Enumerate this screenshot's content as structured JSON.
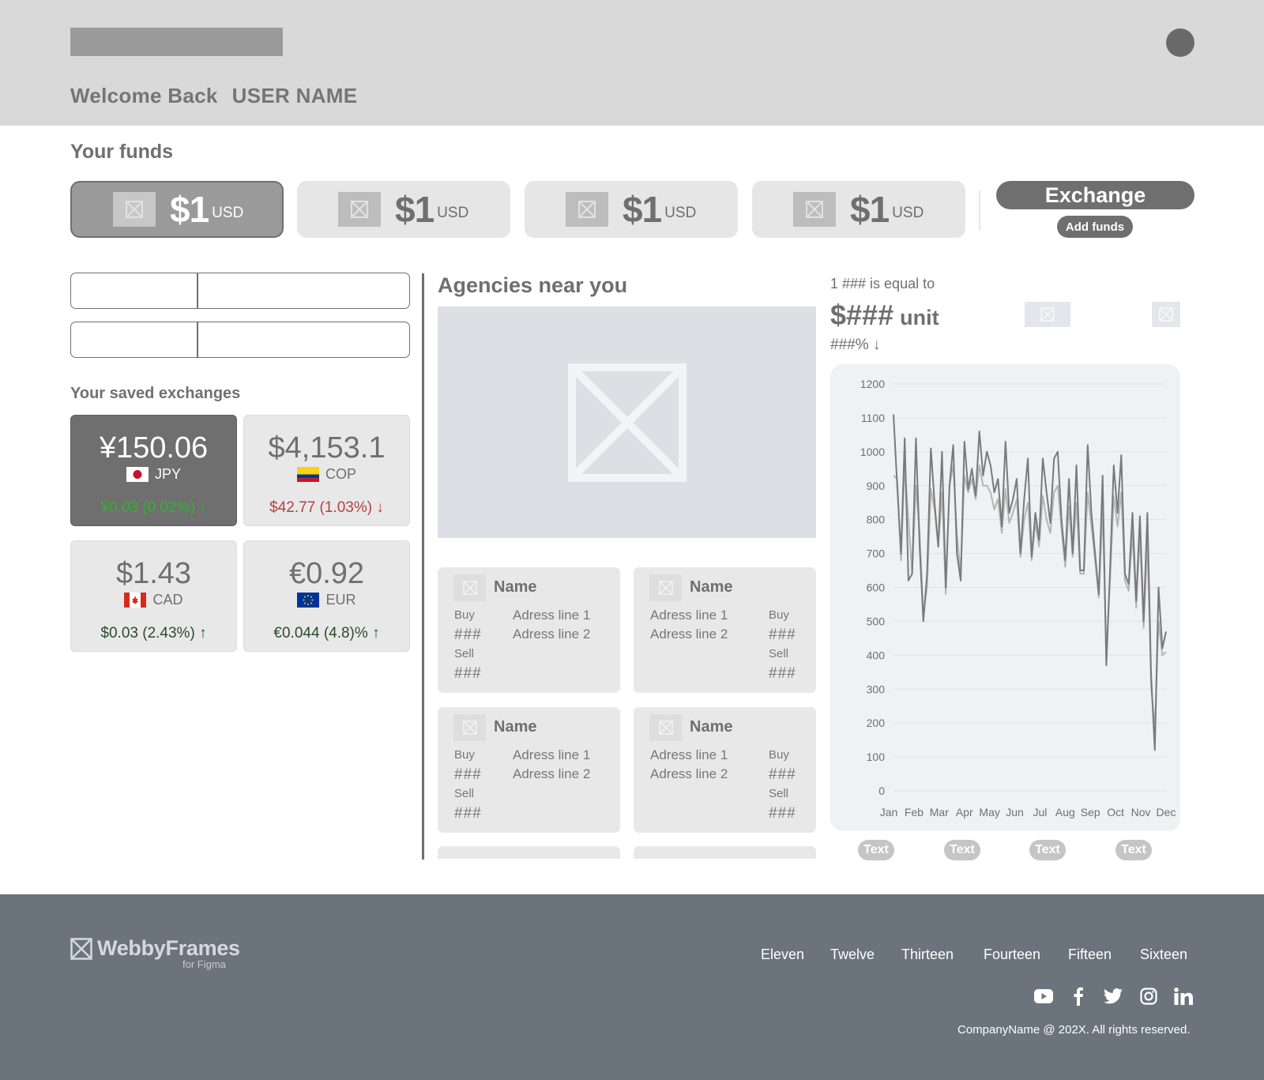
{
  "header": {
    "welcome": "Welcome Back",
    "user_name": "USER NAME"
  },
  "funds": {
    "title": "Your funds",
    "items": [
      {
        "amount": "$1",
        "currency": "USD",
        "active": true
      },
      {
        "amount": "$1",
        "currency": "USD",
        "active": false
      },
      {
        "amount": "$1",
        "currency": "USD",
        "active": false
      },
      {
        "amount": "$1",
        "currency": "USD",
        "active": false
      }
    ],
    "exchange_label": "Exchange",
    "add_funds_label": "Add funds"
  },
  "saved": {
    "title": "Your saved exchanges",
    "cards": [
      {
        "value": "¥150.06",
        "code": "JPY",
        "change": "¥0.03  (0.02%)",
        "direction": "up",
        "flag": "jp"
      },
      {
        "value": "$4,153.1",
        "code": "COP",
        "change": "$42.77 (1.03%)",
        "direction": "down",
        "flag": "co"
      },
      {
        "value": "$1.43",
        "code": "CAD",
        "change": "$0.03  (2.43%)",
        "direction": "up",
        "flag": "ca"
      },
      {
        "value": "€0.92",
        "code": "EUR",
        "change": "€0.044 (4.8)%",
        "direction": "up",
        "flag": "eu"
      }
    ],
    "colors": {
      "up_dark": "#2fb32f",
      "down": "#b54040",
      "up": "#2d4a2d"
    }
  },
  "agencies": {
    "title": "Agencies near you",
    "cards": [
      {
        "name": "Name",
        "buy": "Buy",
        "buy_val": "###",
        "sell": "Sell",
        "sell_val": "###",
        "addr1": "Adress line 1",
        "addr2": "Adress line 2"
      },
      {
        "name": "Name",
        "buy": "Buy",
        "buy_val": "###",
        "sell": "Sell",
        "sell_val": "###",
        "addr1": "Adress line 1",
        "addr2": "Adress line 2"
      },
      {
        "name": "Name",
        "buy": "Buy",
        "buy_val": "###",
        "sell": "Sell",
        "sell_val": "###",
        "addr1": "Adress line 1",
        "addr2": "Adress line 2"
      },
      {
        "name": "Name",
        "buy": "Buy",
        "buy_val": "###",
        "sell": "Sell",
        "sell_val": "###",
        "addr1": "Adress line 1",
        "addr2": "Adress line 2"
      }
    ]
  },
  "rate": {
    "label": "1 ### is equal to",
    "value": "$###",
    "unit": "unit",
    "pct": "###%",
    "pills": [
      "Text",
      "Text",
      "Text",
      "Text"
    ]
  },
  "chart_data": {
    "type": "line",
    "categories": [
      "Jan",
      "Feb",
      "Mar",
      "Apr",
      "May",
      "Jun",
      "Jul",
      "Aug",
      "Sep",
      "Oct",
      "Nov",
      "Dec"
    ],
    "yticks": [
      0,
      100,
      200,
      300,
      400,
      500,
      600,
      700,
      800,
      900,
      1000,
      1100,
      1200
    ],
    "ylim": [
      0,
      1200
    ],
    "grid": true,
    "series": [
      {
        "color": "#7a7a7a",
        "values": [
          1110,
          900,
          700,
          1040,
          620,
          640,
          1040,
          720,
          500,
          640,
          1010,
          850,
          720,
          1000,
          600,
          900,
          1020,
          700,
          620,
          1030,
          890,
          950,
          870,
          1060,
          930,
          1000,
          960,
          880,
          920,
          780,
          1030,
          820,
          860,
          920,
          700,
          860,
          980,
          690,
          820,
          740,
          980,
          880,
          790,
          980,
          1000,
          800,
          680,
          920,
          700,
          960,
          650,
          650,
          1020,
          820,
          700,
          580,
          930,
          370,
          650,
          960,
          820,
          990,
          640,
          610,
          820,
          560,
          810,
          500,
          820,
          340,
          120,
          600,
          420,
          470
        ]
      },
      {
        "color": "#b5b5b5",
        "values": [
          930,
          920,
          680,
          960,
          800,
          640,
          900,
          760,
          520,
          600,
          890,
          830,
          720,
          880,
          580,
          900,
          960,
          760,
          640,
          930,
          880,
          920,
          860,
          960,
          900,
          900,
          880,
          830,
          860,
          760,
          890,
          790,
          820,
          860,
          690,
          800,
          850,
          680,
          790,
          720,
          870,
          800,
          760,
          880,
          900,
          770,
          660,
          840,
          690,
          850,
          640,
          640,
          880,
          780,
          680,
          570,
          830,
          400,
          620,
          870,
          780,
          880,
          620,
          590,
          760,
          540,
          760,
          480,
          740,
          310,
          180,
          500,
          400,
          410
        ]
      }
    ]
  },
  "footer": {
    "brand": "WebbyFrames",
    "brand_sub": "for Figma",
    "nav": [
      "Eleven",
      "Twelve",
      "Thirteen",
      "Fourteen",
      "Fifteen",
      "Sixteen"
    ],
    "social": [
      "youtube-icon",
      "facebook-icon",
      "twitter-icon",
      "instagram-icon",
      "linkedin-icon"
    ],
    "copyright": "CompanyName @ 202X. All rights reserved."
  }
}
